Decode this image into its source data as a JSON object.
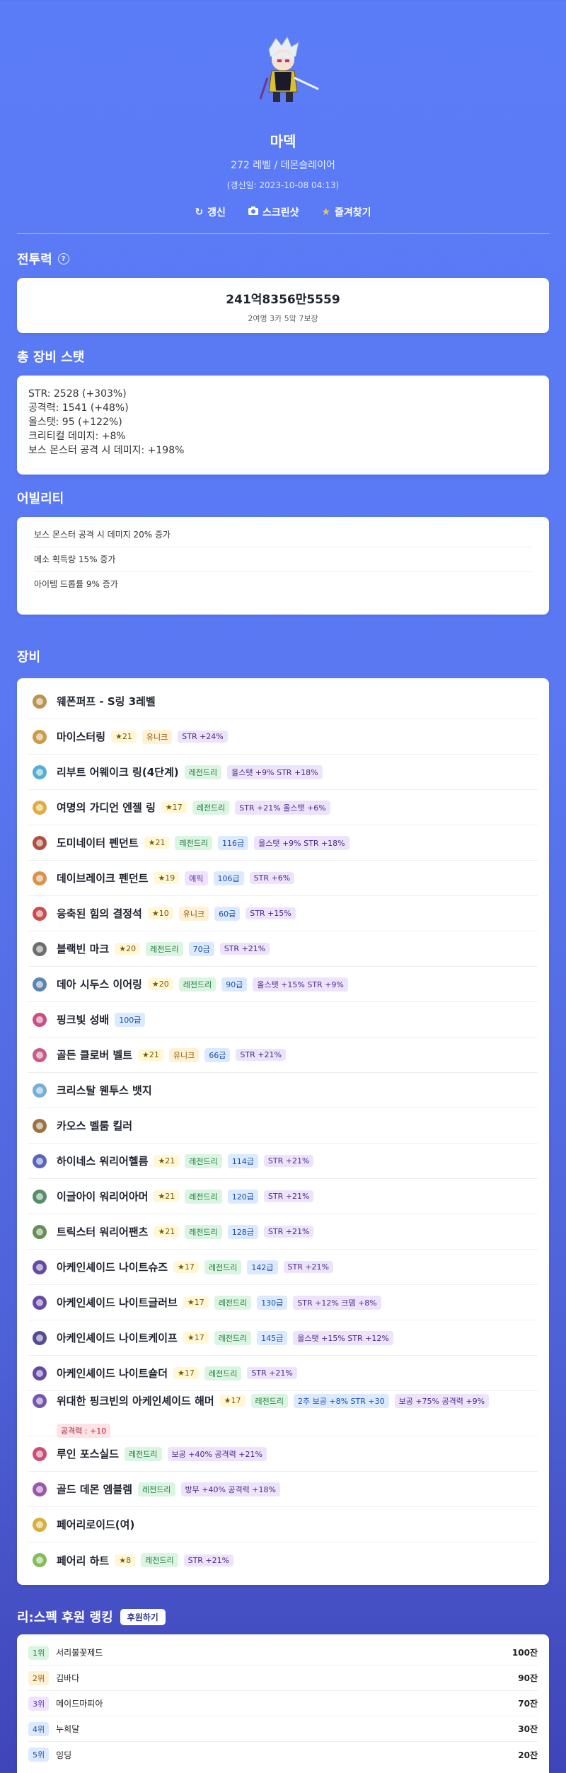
{
  "profile": {
    "name": "마덱",
    "subtitle": "272 레벨 / 데몬슬레이어",
    "updated": "(갱신일: 2023-10-08 04:13)",
    "actions": [
      {
        "label": "갱신",
        "icon": "refresh-icon"
      },
      {
        "label": "스크린샷",
        "icon": "camera-icon"
      },
      {
        "label": "즐겨찾기",
        "icon": "star-icon"
      }
    ]
  },
  "combat_power": {
    "title": "전투력",
    "value": "241억8356만5559",
    "sub": "2여명 3카 5앜 7보장"
  },
  "total_stats": {
    "title": "총 장비 스탯",
    "lines": [
      "STR: 2528 (+303%)",
      "공격력: 1541 (+48%)",
      "올스탯: 95 (+122%)",
      "크리티컬 데미지: +8%",
      "보스 몬스터 공격 시 데미지: +198%"
    ]
  },
  "ability": {
    "title": "어빌리티",
    "lines": [
      "보스 몬스터 공격 시 데미지 20% 증가",
      "메소 획득량 15% 증가",
      "아이템 드롭률 9% 증가"
    ]
  },
  "equipment": {
    "title": "장비",
    "items": [
      {
        "name": "웨폰퍼프 - S링 3레벨",
        "icon": "ring-icon",
        "color": "#b08030",
        "badges": []
      },
      {
        "name": "마이스터링",
        "icon": "ring-icon",
        "color": "#c08a2a",
        "badges": [
          {
            "t": "★21",
            "c": "b-star"
          },
          {
            "t": "유니크",
            "c": "b-unique"
          },
          {
            "t": "STR +24%",
            "c": "b-opt"
          }
        ]
      },
      {
        "name": "리부트 어웨이크 링(4단계)",
        "icon": "ring-icon",
        "color": "#3aa0c8",
        "badges": [
          {
            "t": "레전드리",
            "c": "b-legend"
          },
          {
            "t": "올스탯 +9% STR +18%",
            "c": "b-opt"
          }
        ]
      },
      {
        "name": "여명의 가디언 엔젤 링",
        "icon": "ring-icon",
        "color": "#d8a020",
        "badges": [
          {
            "t": "★17",
            "c": "b-star"
          },
          {
            "t": "레전드리",
            "c": "b-legend"
          },
          {
            "t": "STR +21% 올스탯 +6%",
            "c": "b-opt"
          }
        ]
      },
      {
        "name": "도미네이터 펜던트",
        "icon": "pendant-icon",
        "color": "#a03020",
        "badges": [
          {
            "t": "★21",
            "c": "b-star"
          },
          {
            "t": "레전드리",
            "c": "b-legend"
          },
          {
            "t": "116급",
            "c": "b-grade"
          },
          {
            "t": "올스탯 +9% STR +18%",
            "c": "b-opt"
          }
        ]
      },
      {
        "name": "데이브레이크 펜던트",
        "icon": "pendant-icon",
        "color": "#d08030",
        "badges": [
          {
            "t": "★19",
            "c": "b-star"
          },
          {
            "t": "에픽",
            "c": "b-epic"
          },
          {
            "t": "106급",
            "c": "b-grade"
          },
          {
            "t": "STR +6%",
            "c": "b-opt"
          }
        ]
      },
      {
        "name": "응축된 힘의 결정석",
        "icon": "pocket-icon",
        "color": "#c03030",
        "badges": [
          {
            "t": "★10",
            "c": "b-star"
          },
          {
            "t": "유니크",
            "c": "b-unique"
          },
          {
            "t": "60급",
            "c": "b-grade"
          },
          {
            "t": "STR +15%",
            "c": "b-opt"
          }
        ]
      },
      {
        "name": "블랙빈 마크",
        "icon": "badge-icon",
        "color": "#555555",
        "badges": [
          {
            "t": "★20",
            "c": "b-star"
          },
          {
            "t": "레전드리",
            "c": "b-legend"
          },
          {
            "t": "70급",
            "c": "b-grade"
          },
          {
            "t": "STR +21%",
            "c": "b-opt"
          }
        ]
      },
      {
        "name": "데아 시두스 이어링",
        "icon": "earring-icon",
        "color": "#4070a0",
        "badges": [
          {
            "t": "★20",
            "c": "b-star"
          },
          {
            "t": "레전드리",
            "c": "b-legend"
          },
          {
            "t": "90급",
            "c": "b-grade"
          },
          {
            "t": "올스탯 +15% STR +9%",
            "c": "b-opt"
          }
        ]
      },
      {
        "name": "핑크빛 성배",
        "icon": "cup-icon",
        "color": "#c03070",
        "badges": [
          {
            "t": "100급",
            "c": "b-grade"
          }
        ]
      },
      {
        "name": "골든 클로버 벨트",
        "icon": "belt-icon",
        "color": "#c04070",
        "badges": [
          {
            "t": "★21",
            "c": "b-star"
          },
          {
            "t": "유니크",
            "c": "b-unique"
          },
          {
            "t": "66급",
            "c": "b-grade"
          },
          {
            "t": "STR +21%",
            "c": "b-opt"
          }
        ]
      },
      {
        "name": "크리스탈 웬투스 뱃지",
        "icon": "crystal-icon",
        "color": "#60a0d0",
        "badges": []
      },
      {
        "name": "카오스 벨룸 킬러",
        "icon": "mask-icon",
        "color": "#8a5a20",
        "badges": []
      },
      {
        "name": "하이네스 워리어헬름",
        "icon": "helmet-icon",
        "color": "#3a4ab0",
        "badges": [
          {
            "t": "★21",
            "c": "b-star"
          },
          {
            "t": "레전드리",
            "c": "b-legend"
          },
          {
            "t": "114급",
            "c": "b-grade"
          },
          {
            "t": "STR +21%",
            "c": "b-opt"
          }
        ]
      },
      {
        "name": "이글아이 워리어아머",
        "icon": "armor-icon",
        "color": "#3a7a50",
        "badges": [
          {
            "t": "★21",
            "c": "b-star"
          },
          {
            "t": "레전드리",
            "c": "b-legend"
          },
          {
            "t": "120급",
            "c": "b-grade"
          },
          {
            "t": "STR +21%",
            "c": "b-opt"
          }
        ]
      },
      {
        "name": "트릭스터 워리어팬츠",
        "icon": "pants-icon",
        "color": "#4a7a3a",
        "badges": [
          {
            "t": "★21",
            "c": "b-star"
          },
          {
            "t": "레전드리",
            "c": "b-legend"
          },
          {
            "t": "128급",
            "c": "b-grade"
          },
          {
            "t": "STR +21%",
            "c": "b-opt"
          }
        ]
      },
      {
        "name": "아케인셰이드 나이트슈즈",
        "icon": "shoes-icon",
        "color": "#4a2a90",
        "badges": [
          {
            "t": "★17",
            "c": "b-star"
          },
          {
            "t": "레전드리",
            "c": "b-legend"
          },
          {
            "t": "142급",
            "c": "b-grade"
          },
          {
            "t": "STR +21%",
            "c": "b-opt"
          }
        ]
      },
      {
        "name": "아케인셰이드 나이트글러브",
        "icon": "glove-icon",
        "color": "#4a2a90",
        "badges": [
          {
            "t": "★17",
            "c": "b-star"
          },
          {
            "t": "레전드리",
            "c": "b-legend"
          },
          {
            "t": "130급",
            "c": "b-grade"
          },
          {
            "t": "STR +12% 크뎀 +8%",
            "c": "b-opt"
          }
        ]
      },
      {
        "name": "아케인셰이드 나이트케이프",
        "icon": "cape-icon",
        "color": "#3a2a80",
        "badges": [
          {
            "t": "★17",
            "c": "b-star"
          },
          {
            "t": "레전드리",
            "c": "b-legend"
          },
          {
            "t": "145급",
            "c": "b-grade"
          },
          {
            "t": "올스탯 +15% STR +12%",
            "c": "b-opt"
          }
        ]
      },
      {
        "name": "아케인셰이드 나이트숄더",
        "icon": "shoulder-icon",
        "color": "#4a2a90",
        "badges": [
          {
            "t": "★17",
            "c": "b-star"
          },
          {
            "t": "레전드리",
            "c": "b-legend"
          },
          {
            "t": "STR +21%",
            "c": "b-opt"
          }
        ]
      },
      {
        "name": "위대한 핑크빈의 아케인셰이드 해머",
        "icon": "hammer-icon",
        "color": "#5a3aa0",
        "tall": true,
        "badges": [
          {
            "t": "★17",
            "c": "b-star"
          },
          {
            "t": "레전드리",
            "c": "b-legend"
          },
          {
            "t": "2추 보공 +8% STR +30",
            "c": "b-grade"
          },
          {
            "t": "보공 +75% 공격력 +9%",
            "c": "b-opt"
          },
          {
            "t": "공격력 : +10",
            "c": "b-red",
            "wrap": true
          }
        ]
      },
      {
        "name": "루인 포스실드",
        "icon": "shield-icon",
        "color": "#c03060",
        "badges": [
          {
            "t": "레전드리",
            "c": "b-legend"
          },
          {
            "t": "보공 +40% 공격력 +21%",
            "c": "b-opt"
          }
        ]
      },
      {
        "name": "골드 데몬 엠블렘",
        "icon": "emblem-icon",
        "color": "#8a3aa0",
        "badges": [
          {
            "t": "레전드리",
            "c": "b-legend"
          },
          {
            "t": "방무 +40% 공격력 +18%",
            "c": "b-opt"
          }
        ]
      },
      {
        "name": "페어리로이드(여)",
        "icon": "android-icon",
        "color": "#d0a020",
        "badges": []
      },
      {
        "name": "페어리 하트",
        "icon": "heart-icon",
        "color": "#70b040",
        "badges": [
          {
            "t": "★8",
            "c": "b-star"
          },
          {
            "t": "레전드리",
            "c": "b-legend"
          },
          {
            "t": "STR +21%",
            "c": "b-opt"
          }
        ]
      }
    ]
  },
  "ranking": {
    "title": "리:스펙 후원 랭킹",
    "button": "후원하기",
    "rows": [
      {
        "rank": "1위",
        "name": "서리불꽃제드",
        "amount": "100잔",
        "c": "r1"
      },
      {
        "rank": "2위",
        "name": "김바다",
        "amount": "90잔",
        "c": "r2"
      },
      {
        "rank": "3위",
        "name": "메이드마피아",
        "amount": "70잔",
        "c": "r3"
      },
      {
        "rank": "4위",
        "name": "누희달",
        "amount": "30잔",
        "c": "r4"
      },
      {
        "rank": "5위",
        "name": "잉딩",
        "amount": "20잔",
        "c": "r5"
      }
    ]
  }
}
